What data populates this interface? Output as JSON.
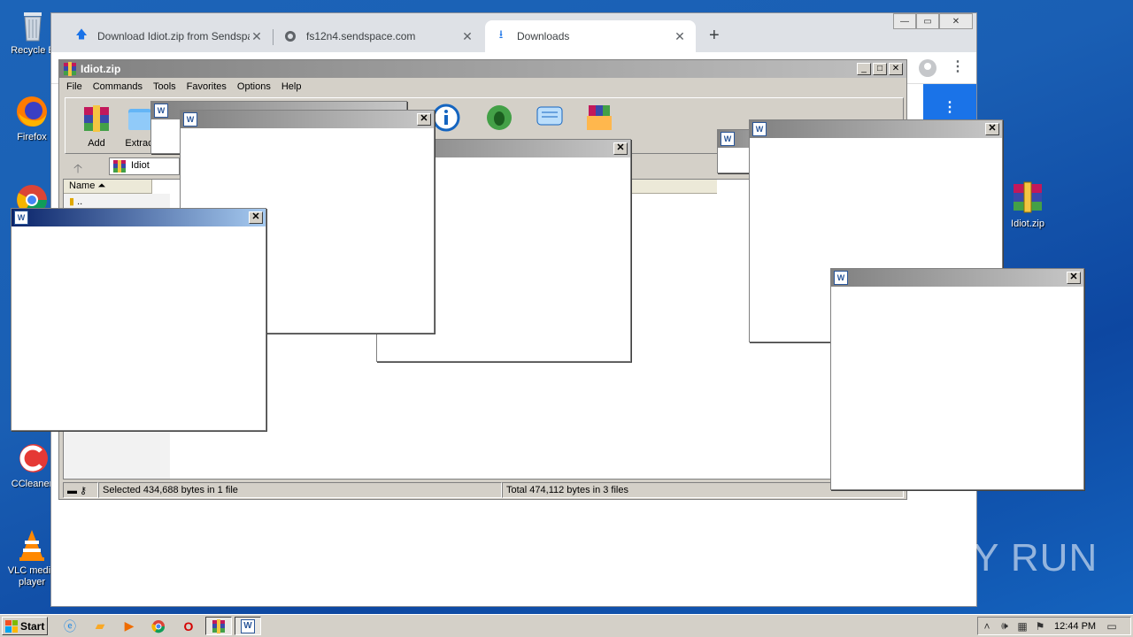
{
  "desktop": {
    "icons": [
      {
        "label": "Recycle B",
        "icon": "recycle-bin-icon"
      },
      {
        "label": "Firefox",
        "icon": "firefox-icon"
      },
      {
        "label": "",
        "icon": "chrome-icon"
      },
      {
        "label": "CCleaner",
        "icon": "ccleaner-icon"
      },
      {
        "label": "VLC media player",
        "icon": "vlc-icon"
      },
      {
        "label": "Idiot.zip",
        "icon": "winrar-archive-icon"
      }
    ]
  },
  "browser": {
    "tabs": [
      {
        "title": "Download Idiot.zip from Sendspace.c",
        "icon": "upload-arrow-icon",
        "active": false
      },
      {
        "title": "fs12n4.sendspace.com",
        "icon": "globe-icon",
        "active": false
      },
      {
        "title": "Downloads",
        "icon": "download-icon",
        "active": true
      }
    ],
    "new_tab": "+",
    "close_glyph": "✕"
  },
  "winrar": {
    "title": "Idiot.zip",
    "menu": [
      "File",
      "Commands",
      "Tools",
      "Favorites",
      "Options",
      "Help"
    ],
    "toolbar": [
      "Add",
      "Extrac"
    ],
    "path": "Idiot",
    "column_name": "Name",
    "updir": "..",
    "status_left": "Selected 434,688 bytes in 1 file",
    "status_right": "Total 474,112 bytes in 3 files"
  },
  "popups": {
    "close_glyph": "✕",
    "icon_letter": "W"
  },
  "taskbar": {
    "start_label": "Start",
    "clock": "12:44 PM"
  },
  "watermark": "ANY RUN",
  "colors": {
    "desktop": "#1a5fb4",
    "chrome_tabbar": "#dee1e6",
    "chrome_accent": "#1a73e8",
    "classic_face": "#d4d0c8"
  }
}
